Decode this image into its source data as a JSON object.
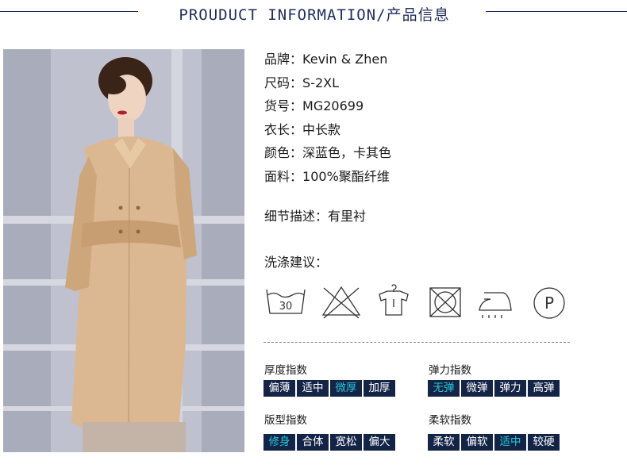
{
  "header": {
    "title": "PROUDUCT INFORMATION/产品信息"
  },
  "specs": [
    {
      "label": "品牌",
      "value": "Kevin & Zhen"
    },
    {
      "label": "尺码",
      "value": "S-2XL"
    },
    {
      "label": "货号",
      "value": "MG20699"
    },
    {
      "label": "衣长",
      "value": "中长款"
    },
    {
      "label": "颜色",
      "value": "深蓝色，卡其色"
    },
    {
      "label": "面料",
      "value": "100%聚酯纤维"
    }
  ],
  "detail": {
    "label": "细节描述",
    "value": "有里衬"
  },
  "care": {
    "title": "洗涤建议：",
    "icons": [
      {
        "icon": "wash-30-icon",
        "text": "30"
      },
      {
        "icon": "no-bleach-icon"
      },
      {
        "icon": "hang-dry-icon"
      },
      {
        "icon": "no-tumble-dry-icon"
      },
      {
        "icon": "iron-icon"
      },
      {
        "icon": "dry-clean-p-icon",
        "text": "P"
      }
    ]
  },
  "indices": [
    {
      "title": "厚度指数",
      "options": [
        "偏薄",
        "适中",
        "微厚",
        "加厚"
      ],
      "active": 2
    },
    {
      "title": "弹力指数",
      "options": [
        "无弹",
        "微弹",
        "弹力",
        "高弹"
      ],
      "active": 0
    },
    {
      "title": "版型指数",
      "options": [
        "修身",
        "合体",
        "宽松",
        "偏大"
      ],
      "active": 0
    },
    {
      "title": "柔软指数",
      "options": [
        "柔软",
        "偏软",
        "适中",
        "较硬"
      ],
      "active": 2
    }
  ],
  "colors": {
    "navy": "#142447",
    "active_text": "#27c7d9",
    "coat": "#dbb892"
  }
}
